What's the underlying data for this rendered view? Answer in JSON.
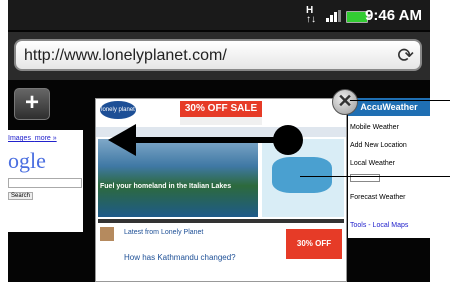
{
  "status": {
    "time": "9:46 AM",
    "network": "H↑↓"
  },
  "browser": {
    "url": "http://www.lonelyplanet.com/",
    "new_window_label": "+",
    "close_label": "✕"
  },
  "left_window": {
    "links": [
      "Images",
      "more »"
    ],
    "logo_text": "ogle",
    "button": "Search"
  },
  "center_window": {
    "logo": "lonely planet",
    "ad_text": "30% OFF SALE",
    "hero_caption": "Fuel your homeland in the Italian Lakes",
    "section_title": "Latest from Lonely Planet",
    "article_link": "How has Kathmandu changed?",
    "ad2_text": "30% OFF"
  },
  "right_window": {
    "brand": "AccuWeather",
    "items": [
      "Mobile Weather",
      "Add New Location",
      "Local Weather",
      "Forecast Weather",
      "Tools - Local Maps"
    ]
  },
  "icons": {
    "refresh": "refresh-icon",
    "close": "close-icon",
    "plus": "plus-icon",
    "swipe": "swipe-left-arrow-icon"
  },
  "colors": {
    "ad_red": "#e63b27",
    "hero_blue": "#2a6fa8",
    "battery_green": "#33cc33",
    "accu_blue": "#1f6fb3"
  }
}
